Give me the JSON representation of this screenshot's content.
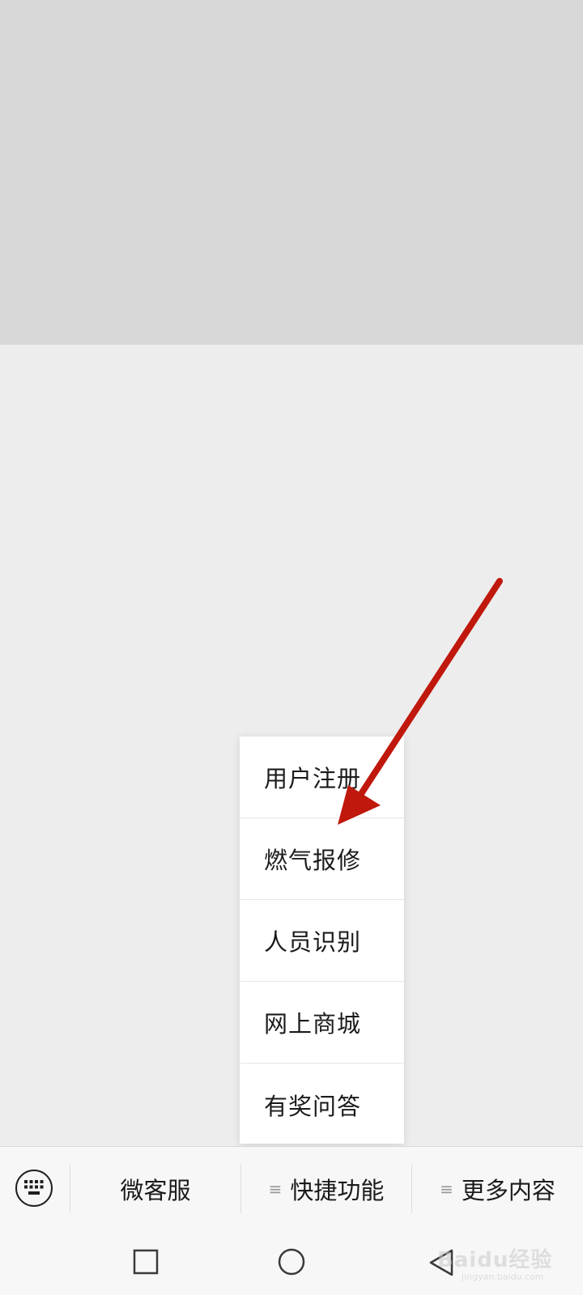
{
  "menu": {
    "items": [
      {
        "label": "用户注册"
      },
      {
        "label": "燃气报修"
      },
      {
        "label": "人员识别"
      },
      {
        "label": "网上商城"
      },
      {
        "label": "有奖问答"
      }
    ]
  },
  "bottom_bar": {
    "keyboard_icon": "keyboard-icon",
    "tabs": [
      {
        "label": "微客服",
        "has_menu_icon": false
      },
      {
        "label": "快捷功能",
        "has_menu_icon": true
      },
      {
        "label": "更多内容",
        "has_menu_icon": true
      }
    ],
    "menu_glyph": "≡"
  },
  "nav": {
    "icons": [
      "recent-apps-icon",
      "home-icon",
      "back-icon"
    ]
  },
  "annotation": {
    "arrow_color": "#c0180c"
  },
  "watermark": {
    "main": "Baidu经验",
    "sub": "jingyan.baidu.com"
  }
}
